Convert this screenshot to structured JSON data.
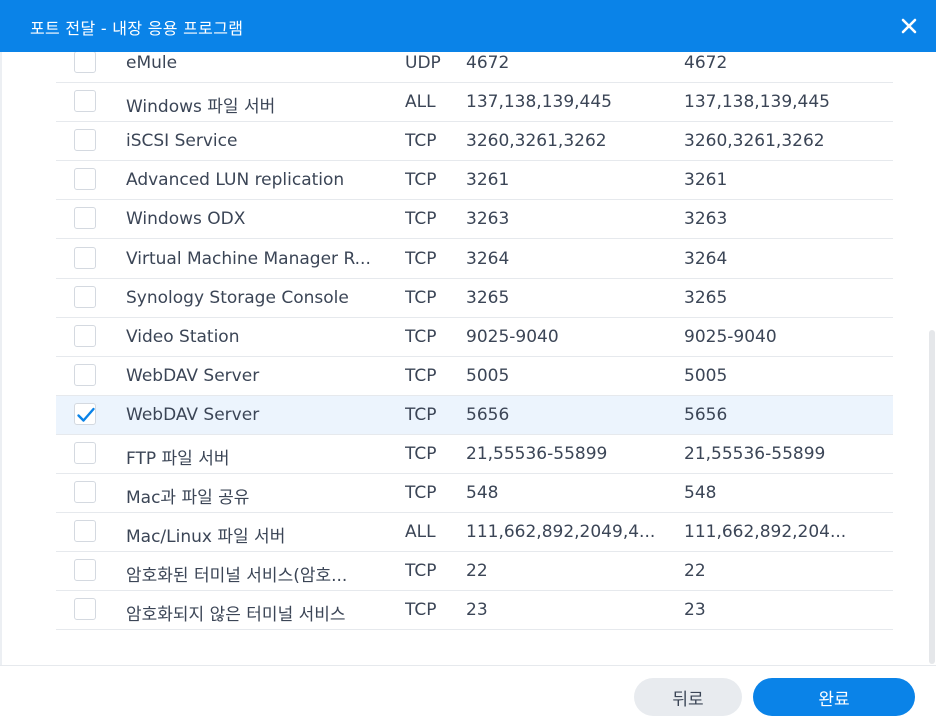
{
  "dialog": {
    "title": "포트 전달 - 내장 응용 프로그램",
    "close_icon": "close-icon"
  },
  "rows": [
    {
      "name": "eMule",
      "protocol": "UDP",
      "port1": "4672",
      "port2": "4672",
      "checked": false
    },
    {
      "name": "Windows 파일 서버",
      "protocol": "ALL",
      "port1": "137,138,139,445",
      "port2": "137,138,139,445",
      "checked": false
    },
    {
      "name": "iSCSI Service",
      "protocol": "TCP",
      "port1": "3260,3261,3262",
      "port2": "3260,3261,3262",
      "checked": false
    },
    {
      "name": "Advanced LUN replication",
      "protocol": "TCP",
      "port1": "3261",
      "port2": "3261",
      "checked": false
    },
    {
      "name": "Windows ODX",
      "protocol": "TCP",
      "port1": "3263",
      "port2": "3263",
      "checked": false
    },
    {
      "name": "Virtual Machine Manager R...",
      "protocol": "TCP",
      "port1": "3264",
      "port2": "3264",
      "checked": false
    },
    {
      "name": "Synology Storage Console",
      "protocol": "TCP",
      "port1": "3265",
      "port2": "3265",
      "checked": false
    },
    {
      "name": "Video Station",
      "protocol": "TCP",
      "port1": "9025-9040",
      "port2": "9025-9040",
      "checked": false
    },
    {
      "name": "WebDAV Server",
      "protocol": "TCP",
      "port1": "5005",
      "port2": "5005",
      "checked": false
    },
    {
      "name": "WebDAV Server",
      "protocol": "TCP",
      "port1": "5656",
      "port2": "5656",
      "checked": true
    },
    {
      "name": "FTP 파일 서버",
      "protocol": "TCP",
      "port1": "21,55536-55899",
      "port2": "21,55536-55899",
      "checked": false
    },
    {
      "name": "Mac과 파일 공유",
      "protocol": "TCP",
      "port1": "548",
      "port2": "548",
      "checked": false
    },
    {
      "name": "Mac/Linux 파일 서버",
      "protocol": "ALL",
      "port1": "111,662,892,2049,4...",
      "port2": "111,662,892,204...",
      "checked": false
    },
    {
      "name": "암호화된 터미널 서비스(암호...",
      "protocol": "TCP",
      "port1": "22",
      "port2": "22",
      "checked": false
    },
    {
      "name": "암호화되지 않은 터미널 서비스",
      "protocol": "TCP",
      "port1": "23",
      "port2": "23",
      "checked": false
    }
  ],
  "footer": {
    "back_label": "뒤로",
    "done_label": "완료"
  },
  "colors": {
    "accent": "#0a83e8",
    "selected_row": "#ecf4fd"
  }
}
